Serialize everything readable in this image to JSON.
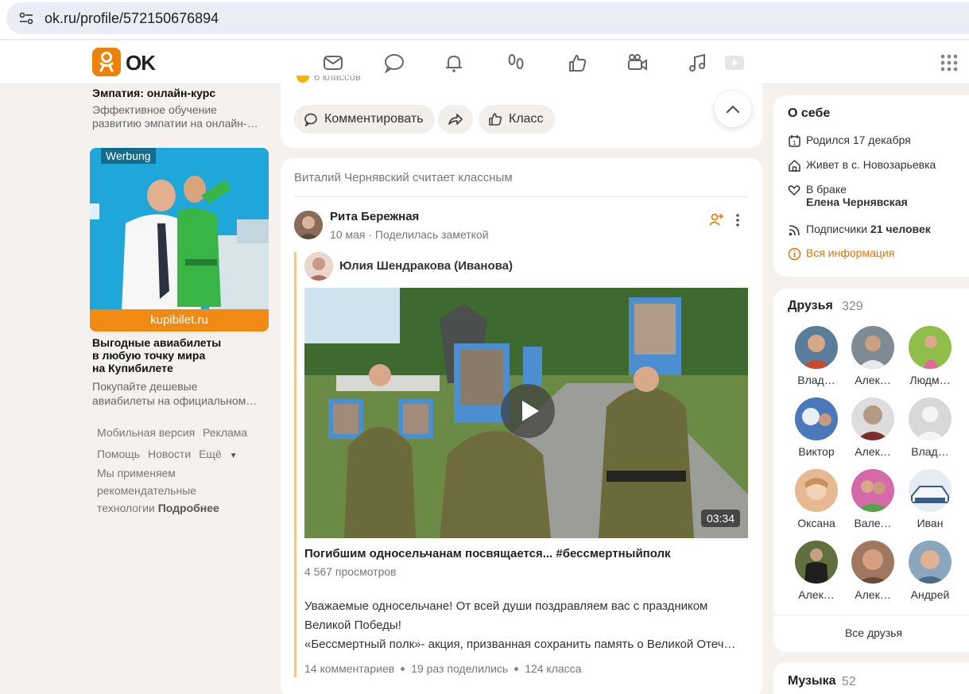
{
  "browser": {
    "url": "ok.ru/profile/572150676894"
  },
  "header": {
    "logo_text": "OK"
  },
  "left": {
    "ad1": {
      "title": "Эмпатия: онлайн-курс",
      "desc1": "Эффективное обучение",
      "desc2": "развитию эмпатии на онлайн-…"
    },
    "ad2": {
      "badge": "Werbung",
      "brand": "kupibilet.ru",
      "title1": "Выгодные авиабилеты",
      "title2": "в любую точку мира",
      "title3": "на Купибилете",
      "desc1": "Покупайте дешевые",
      "desc2": "авиабилеты на официальном…"
    },
    "footer": {
      "mobile": "Мобильная версия",
      "ads": "Реклама",
      "help": "Помощь",
      "news": "Новости",
      "more": "Ещё",
      "note1": "Мы применяем",
      "note2": "рекомендательные",
      "note3": "технологии",
      "note_link": "Подробнее"
    }
  },
  "feed": {
    "post1": {
      "likes_text": "6 классов",
      "comment_label": "Комментировать",
      "class_label": "Класс"
    },
    "post2": {
      "liked_by": "Виталий Чернявский считает классным",
      "author": "Рита Бережная",
      "date": "10 мая",
      "action": "Поделилась заметкой",
      "repost_author": "Юлия Шендракова (Иванова)",
      "video_duration": "03:34",
      "video_title": "Погибшим односельчанам посвящается... #бессмертныйполк",
      "views": "4 567 просмотров",
      "text1": "Уважаемые односельчане! От всей души поздравляем вас с праздником",
      "text2": "Великой Победы!",
      "text3": "«Бессмертный полк»- акция, призванная сохранить память о Великой Отечественной войне",
      "comments": "14 комментариев",
      "shares": "19 раз поделились",
      "classes": "124 класса"
    }
  },
  "about": {
    "title": "О себе",
    "born": "Родился 17 декабря",
    "lives": "Живет в с. Новозарьевка",
    "married": "В браке",
    "spouse": "Елена Чернявская",
    "subs_label": "Подписчики",
    "subs_value": "21 человек",
    "all_info": "Вся информация"
  },
  "friends": {
    "title": "Друзья",
    "count": "329",
    "items": [
      {
        "name": "Влад…",
        "color": "#5a7d9a"
      },
      {
        "name": "Алек…",
        "color": "#7f8b94"
      },
      {
        "name": "Людм…",
        "color": "#8fbf4a"
      },
      {
        "name": "Виктор",
        "color": "#4a78b8"
      },
      {
        "name": "Алек…",
        "color": "#b49a86"
      },
      {
        "name": "Влад…",
        "color": "#d8d8d8"
      },
      {
        "name": "Оксана",
        "color": "#e7b992"
      },
      {
        "name": "Вале…",
        "color": "#d46aa8"
      },
      {
        "name": "Иван",
        "color": "#3a5c8a"
      },
      {
        "name": "Алек…",
        "color": "#5f6f3e"
      },
      {
        "name": "Алек…",
        "color": "#a07862"
      },
      {
        "name": "Андрей",
        "color": "#8aa6bd"
      }
    ],
    "all_label": "Все друзья"
  },
  "music": {
    "title": "Музыка",
    "count": "52"
  },
  "colors": {
    "accent": "#ee8208",
    "link": "#e0760c"
  }
}
